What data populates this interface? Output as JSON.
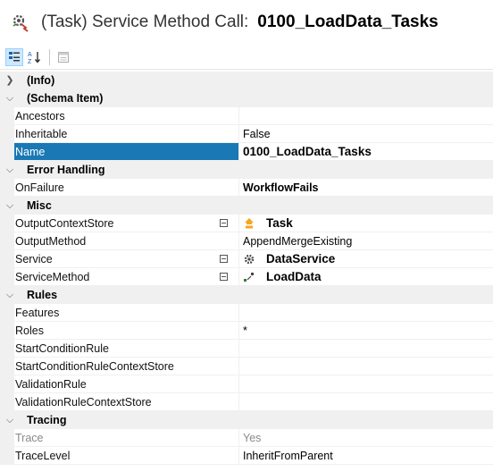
{
  "header": {
    "title": "(Task) Service Method Call:",
    "name": "0100_LoadData_Tasks",
    "icon": "service-method-call-icon"
  },
  "toolbar": {
    "buttons": [
      "categorized-icon",
      "alphabetical-sort-icon",
      "property-pages-icon"
    ]
  },
  "categories": {
    "info": {
      "label": "(Info)",
      "expanded": false
    },
    "schema_item": {
      "label": "(Schema Item)",
      "expanded": true
    },
    "error_handling": {
      "label": "Error Handling",
      "expanded": true
    },
    "misc": {
      "label": "Misc",
      "expanded": true
    },
    "rules": {
      "label": "Rules",
      "expanded": true
    },
    "tracing": {
      "label": "Tracing",
      "expanded": true
    }
  },
  "props": {
    "ancestors": {
      "name": "Ancestors",
      "value": ""
    },
    "inheritable": {
      "name": "Inheritable",
      "value": "False"
    },
    "name": {
      "name": "Name",
      "value": "0100_LoadData_Tasks"
    },
    "onfailure": {
      "name": "OnFailure",
      "value": "WorkflowFails"
    },
    "output_context_store": {
      "name": "OutputContextStore",
      "value": "Task",
      "icon": "context-store-icon"
    },
    "output_method": {
      "name": "OutputMethod",
      "value": "AppendMergeExisting"
    },
    "service": {
      "name": "Service",
      "value": "DataService",
      "icon": "service-gear-icon"
    },
    "service_method": {
      "name": "ServiceMethod",
      "value": "LoadData",
      "icon": "method-icon"
    },
    "features": {
      "name": "Features",
      "value": ""
    },
    "roles": {
      "name": "Roles",
      "value": "*"
    },
    "start_condition_rule": {
      "name": "StartConditionRule",
      "value": ""
    },
    "start_condition_rule_context_store": {
      "name": "StartConditionRuleContextStore",
      "value": ""
    },
    "validation_rule": {
      "name": "ValidationRule",
      "value": ""
    },
    "validation_rule_context_store": {
      "name": "ValidationRuleContextStore",
      "value": ""
    },
    "trace": {
      "name": "Trace",
      "value": "Yes"
    },
    "trace_level": {
      "name": "TraceLevel",
      "value": "InheritFromParent"
    }
  },
  "colors": {
    "selection": "#1a78b4",
    "category_bg": "#f0f0f0",
    "disabled_text": "#8a8a8a"
  }
}
